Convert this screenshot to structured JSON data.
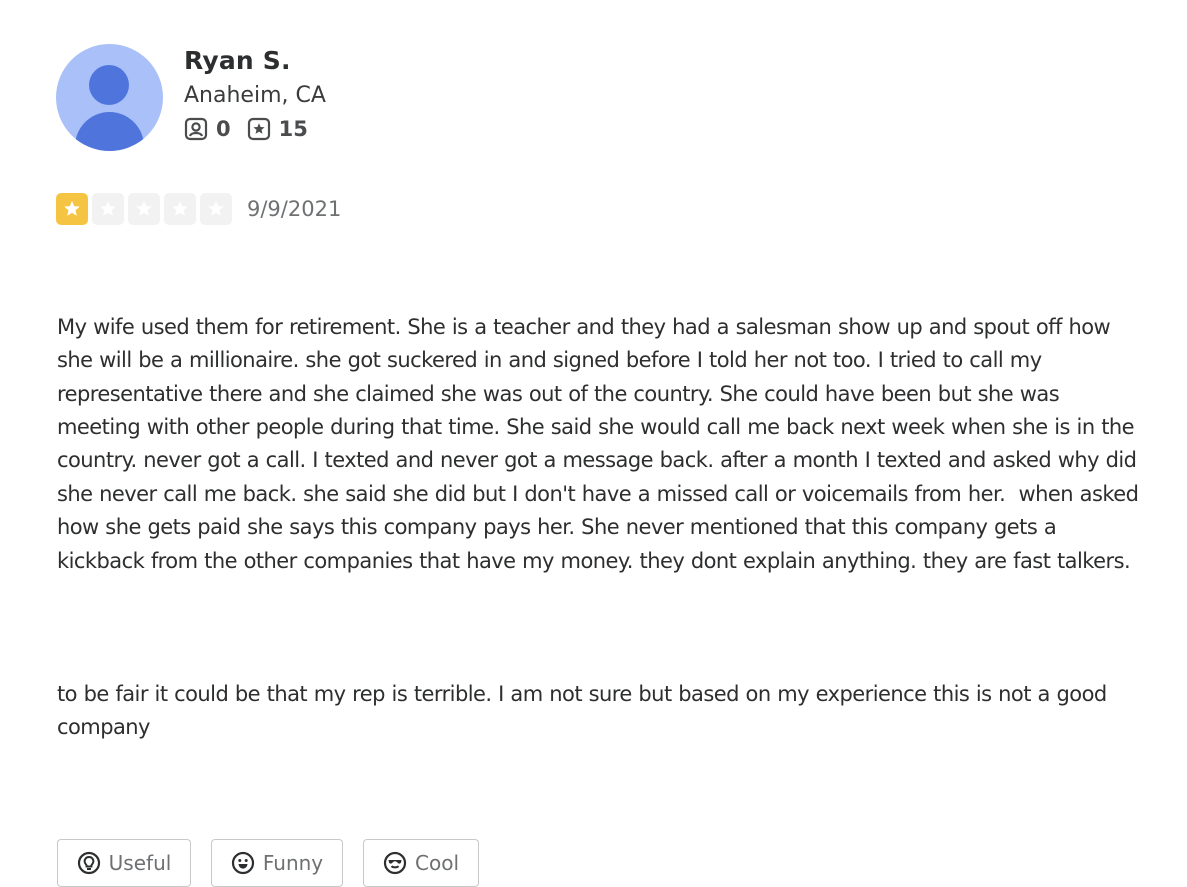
{
  "user": {
    "name": "Ryan S.",
    "location": "Anaheim, CA",
    "friends_count": "0",
    "reviews_count": "15",
    "avatar_icon": "default-user-avatar",
    "avatar_bg": "#a9c0f8",
    "avatar_fg": "#4f75dc"
  },
  "review": {
    "rating": 1,
    "max_rating": 5,
    "star_color": "#f6c443",
    "date": "9/9/2021",
    "paragraphs": [
      "My wife used them for retirement. She is a teacher and they had a salesman show up and spout off how she will be a millionaire. she got suckered in and signed before I told her not too. I tried to call my representative there and she claimed she was out of the country. She could have been but she was meeting with other people during that time. She said she would call me back next week when she is in the country. never got a call. I texted and never got a message back. after a month I texted and asked why did she never call me back. she said she did but I don't have a missed call or voicemails from her.  when asked how she gets paid she says this company pays her. She never mentioned that this company gets a kickback from the other companies that have my money. they dont explain anything. they are fast talkers.",
      "to be fair it could be that my rep is terrible. I am not sure but based on my experience this is not a good company"
    ]
  },
  "reactions": {
    "useful_label": "Useful",
    "funny_label": "Funny",
    "cool_label": "Cool"
  }
}
